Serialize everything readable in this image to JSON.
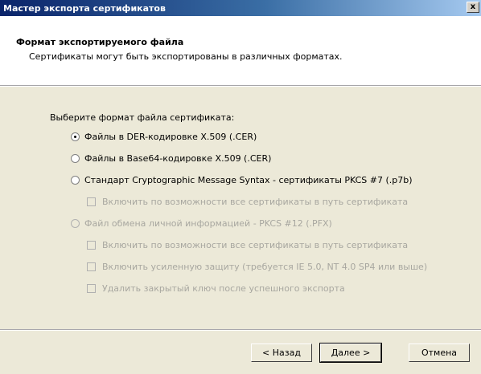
{
  "window": {
    "title": "Мастер экспорта сертификатов",
    "close_label": "x"
  },
  "header": {
    "title": "Формат экспортируемого файла",
    "subtitle": "Сертификаты могут быть экспортированы в различных форматах."
  },
  "prompt": "Выберите формат файла сертификата:",
  "options": {
    "der": {
      "label": "Файлы в DER-кодировке X.509 (.CER)",
      "selected": true
    },
    "base64": {
      "label": "Файлы в Base64-кодировке X.509 (.CER)",
      "selected": false
    },
    "pkcs7": {
      "label": "Стандарт Cryptographic Message Syntax - сертификаты PKCS #7 (.p7b)",
      "selected": false
    },
    "pkcs7_include_chain": {
      "label": "Включить по возможности все сертификаты в путь сертификата",
      "checked": false,
      "enabled": false
    },
    "pfx": {
      "label": "Файл обмена личной информацией - PKCS #12 (.PFX)",
      "selected": false,
      "enabled": false
    },
    "pfx_include_chain": {
      "label": "Включить по возможности все сертификаты в путь сертификата",
      "checked": false,
      "enabled": false
    },
    "pfx_strong_protection": {
      "label": "Включить усиленную защиту (требуется IE 5.0, NT 4.0 SP4 или выше)",
      "checked": false,
      "enabled": false
    },
    "pfx_delete_key": {
      "label": "Удалить закрытый ключ после успешного экспорта",
      "checked": false,
      "enabled": false
    }
  },
  "buttons": {
    "back": "< Назад",
    "next": "Далее >",
    "cancel": "Отмена"
  }
}
